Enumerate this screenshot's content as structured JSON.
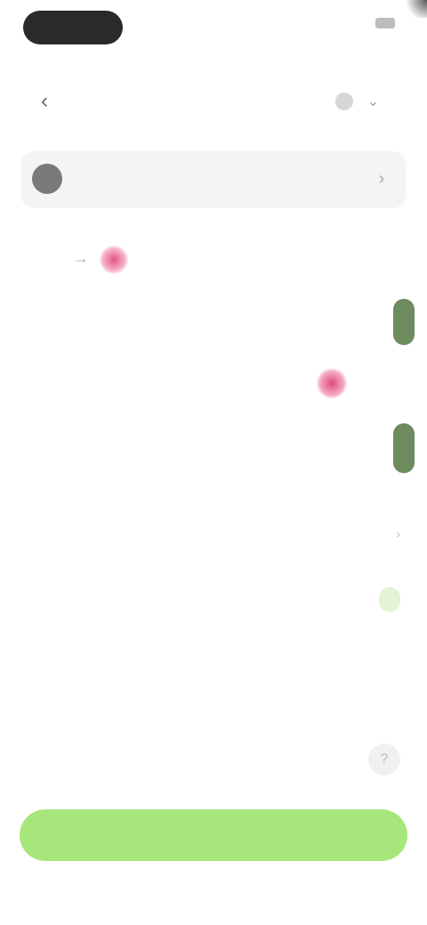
{
  "status_bar": {
    "time": "",
    "right_text": ""
  },
  "nav": {
    "network_label": ""
  },
  "info_card": {
    "title": "",
    "subtitle": ""
  },
  "from": {
    "label": "",
    "address": ""
  },
  "amounts": {
    "primary": "",
    "label": "",
    "secondary": ""
  },
  "details": [
    {
      "label": "",
      "value": ""
    },
    {
      "label": "",
      "value": ""
    }
  ],
  "primary_button": {
    "label": ""
  },
  "colors": {
    "accent": "#a7e67b",
    "amount_highlight": "#6e8a5f",
    "token": "#e35482",
    "badge_bg": "#e4f3d4"
  }
}
